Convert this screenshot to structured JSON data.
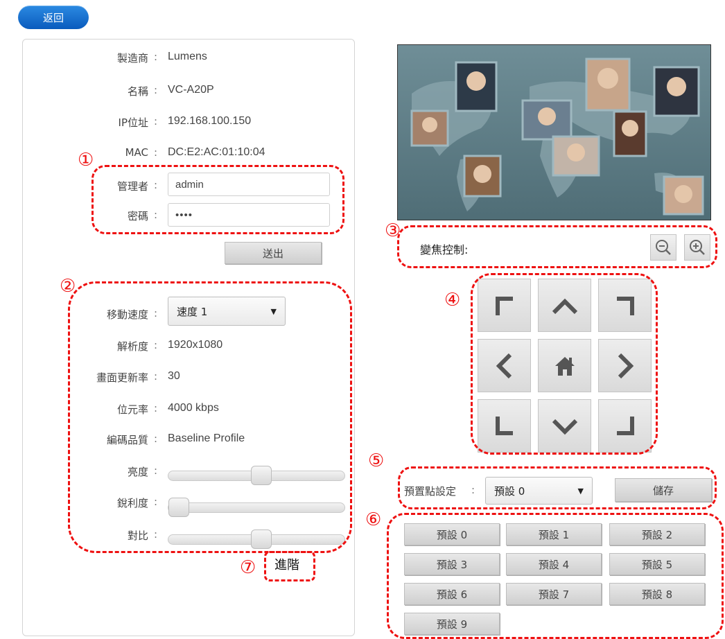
{
  "nav": {
    "back_label": "返回"
  },
  "device": {
    "manufacturer_label": "製造商",
    "manufacturer_value": "Lumens",
    "name_label": "名稱",
    "name_value": "VC-A20P",
    "ip_label": "IP位址",
    "ip_value": "192.168.100.150",
    "mac_label": "MAC",
    "mac_value": "DC:E2:AC:01:10:04",
    "colon": ":"
  },
  "login": {
    "admin_label": "管理者",
    "admin_value": "admin",
    "password_label": "密碼",
    "password_value": "••••",
    "submit_label": "送出"
  },
  "settings": {
    "speed_label": "移動速度",
    "speed_value": "速度 1",
    "resolution_label": "解析度",
    "resolution_value": "1920x1080",
    "framerate_label": "畫面更新率",
    "framerate_value": "30",
    "bitrate_label": "位元率",
    "bitrate_value": "4000 kbps",
    "profile_label": "編碼品質",
    "profile_value": "Baseline Profile",
    "brightness_label": "亮度",
    "brightness_level": 0.53,
    "sharpness_label": "銳利度",
    "sharpness_level": 0.0,
    "contrast_label": "對比",
    "contrast_level": 0.53,
    "advanced_label": "進階"
  },
  "zoom": {
    "label": "變焦控制:"
  },
  "preset": {
    "label": "預置點設定",
    "selected": "預設 0",
    "save_label": "儲存",
    "buttons": [
      "預設 0",
      "預設 1",
      "預設 2",
      "預設 3",
      "預設 4",
      "預設 5",
      "預設 6",
      "預設 7",
      "預設 8",
      "預設 9"
    ]
  },
  "markers": [
    "①",
    "②",
    "③",
    "④",
    "⑤",
    "⑥",
    "⑦"
  ],
  "colors": {
    "accent": "#0a5bbd",
    "annotation": "#e11111"
  }
}
